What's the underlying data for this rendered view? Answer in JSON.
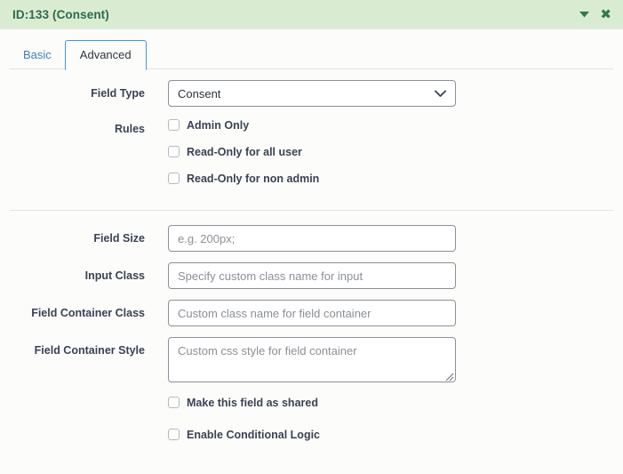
{
  "header": {
    "title": "ID:133 (Consent)",
    "collapse_icon": "caret-down-icon",
    "close_icon": "close-icon",
    "background_color": "#d9ecd1",
    "title_color": "#2d6a4a"
  },
  "tabs": [
    {
      "label": "Basic",
      "active": false
    },
    {
      "label": "Advanced",
      "active": true
    }
  ],
  "form": {
    "field_type": {
      "label": "Field Type",
      "value": "Consent",
      "caret_icon": "chevron-down-icon"
    },
    "rules": {
      "label": "Rules",
      "options": [
        {
          "label": "Admin Only",
          "checked": false
        },
        {
          "label": "Read-Only for all user",
          "checked": false
        },
        {
          "label": "Read-Only for non admin",
          "checked": false
        }
      ]
    },
    "field_size": {
      "label": "Field Size",
      "value": "",
      "placeholder": "e.g. 200px;"
    },
    "input_class": {
      "label": "Input Class",
      "value": "",
      "placeholder": "Specify custom class name for input"
    },
    "field_container_class": {
      "label": "Field Container Class",
      "value": "",
      "placeholder": "Custom class name for field container"
    },
    "field_container_style": {
      "label": "Field Container Style",
      "value": "",
      "placeholder": "Custom css style for field container",
      "resize_icon": "resize-grip-icon"
    },
    "shared": {
      "label": "Make this field as shared",
      "checked": false
    },
    "conditional_logic": {
      "label": "Enable Conditional Logic",
      "checked": false
    }
  },
  "colors": {
    "accent_blue": "#3d96dd",
    "link_blue": "#3c7fc4",
    "label_navy": "#3a4253",
    "body_background": "#fcfdfb"
  }
}
